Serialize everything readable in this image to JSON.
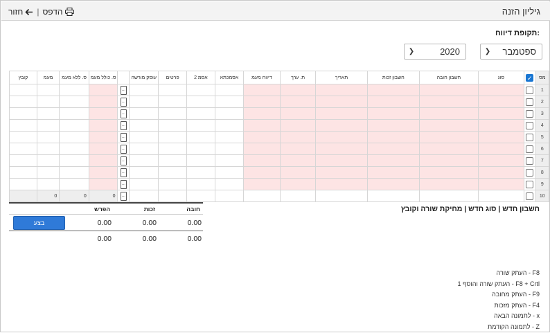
{
  "header": {
    "title": "גיליון הזנה",
    "print_label": "הדפס",
    "back_label": "חזור"
  },
  "period": {
    "label": "תקופת דיווח:",
    "month": "ספטמבר",
    "year": "2020"
  },
  "grid": {
    "columns": [
      "מס",
      "סוג",
      "חשבון חובה",
      "חשבון זכות",
      "תאריך",
      "ת. ערך",
      "דיווח מעמ",
      "אסמכתא",
      "אסמ 2",
      "פרטים",
      "עוסק מורשה",
      "ס. כולל מעמ",
      "ס. ללא מעמ",
      "מעמ",
      "קובץ"
    ],
    "row_numbers": [
      "1",
      "2",
      "3",
      "4",
      "5",
      "6",
      "7",
      "8",
      "9",
      "10"
    ],
    "totals": {
      "total_with_vat": "0",
      "total_without_vat": "0",
      "vat": "0"
    }
  },
  "links": {
    "new_account": "חשבון חדש",
    "new_type": "סוג חדש",
    "delete_row_file": "מחיקת שורה וקובץ"
  },
  "summary": {
    "headers": {
      "debit": "חובה",
      "credit": "זכות",
      "diff": "הפרש"
    },
    "row1": {
      "debit": "0.00",
      "credit": "0.00",
      "diff": "0.00"
    },
    "row2": {
      "debit": "0.00",
      "credit": "0.00",
      "diff": "0.00"
    },
    "execute_label": "בצע"
  },
  "shortcuts": [
    "F8 - העתק שורה",
    "F8 + Crtl - העתק שורה והוסף 1",
    "F9 - העתק מחובה",
    "F4 - העתק מזכות",
    "x - לתמונה הבאה",
    "Z - לתמונה הקודמת"
  ],
  "colors": {
    "pink_cell": "#fde4e4",
    "button_blue": "#2f7ad8",
    "checkbox_blue": "#1976d2"
  },
  "icons": [
    "printer-icon",
    "arrow-left-icon",
    "chevron-down-icon",
    "checkbox-icon"
  ]
}
